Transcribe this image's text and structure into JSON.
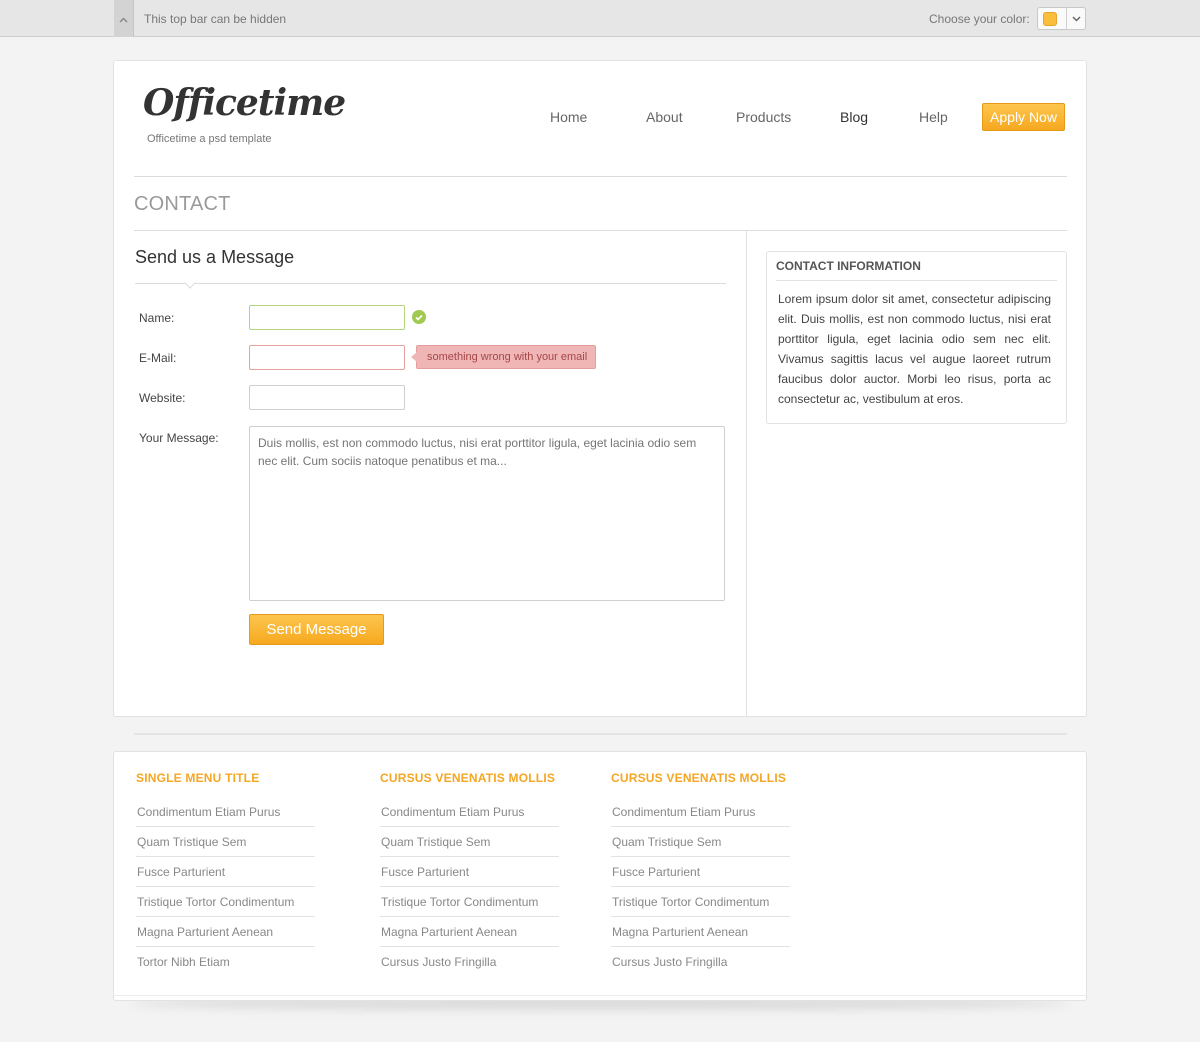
{
  "topbar": {
    "hide_text": "This top bar can be hidden",
    "color_label": "Choose your color:",
    "selected_color": "#fbbd3c"
  },
  "header": {
    "logo": "Officetime",
    "tagline": "Officetime a psd template",
    "nav": [
      "Home",
      "About",
      "Products",
      "Blog",
      "Help"
    ],
    "active_nav": "Blog",
    "cta": "Apply Now"
  },
  "page": {
    "title": "CONTACT"
  },
  "form": {
    "heading": "Send us a Message",
    "name_label": "Name:",
    "name_value": "",
    "email_label": "E-Mail:",
    "email_value": "",
    "email_error": "something wrong with your email",
    "website_label": "Website:",
    "website_value": "",
    "message_label": "Your Message:",
    "message_placeholder": "Duis mollis, est non commodo luctus, nisi erat porttitor ligula, eget lacinia odio sem nec elit. Cum sociis natoque penatibus et ma...",
    "submit": "Send Message"
  },
  "sidebar": {
    "title": "CONTACT INFORMATION",
    "text": "Lorem ipsum dolor sit amet, consectetur adipiscing elit. Duis mollis, est non commodo luctus, nisi erat porttitor ligula, eget lacinia odio sem nec elit. Vivamus sagittis lacus vel augue laoreet rutrum faucibus dolor auctor. Morbi leo risus, porta ac consectetur ac, vestibulum at eros."
  },
  "footer": {
    "accent_color": "#f5a623",
    "columns": [
      {
        "title": "SINGLE MENU TITLE",
        "links": [
          "Condimentum Etiam Purus",
          "Quam Tristique Sem",
          "Fusce Parturient",
          "Tristique Tortor Condimentum",
          "Magna Parturient Aenean",
          "Tortor Nibh Etiam"
        ]
      },
      {
        "title": "CURSUS VENENATIS MOLLIS",
        "links": [
          "Condimentum Etiam Purus",
          "Quam Tristique Sem",
          "Fusce Parturient",
          "Tristique Tortor Condimentum",
          "Magna Parturient Aenean",
          "Cursus Justo Fringilla"
        ]
      },
      {
        "title": "CURSUS VENENATIS MOLLIS",
        "links": [
          "Condimentum Etiam Purus",
          "Quam Tristique Sem",
          "Fusce Parturient",
          "Tristique Tortor Condimentum",
          "Magna Parturient Aenean",
          "Cursus Justo Fringilla"
        ]
      }
    ]
  }
}
